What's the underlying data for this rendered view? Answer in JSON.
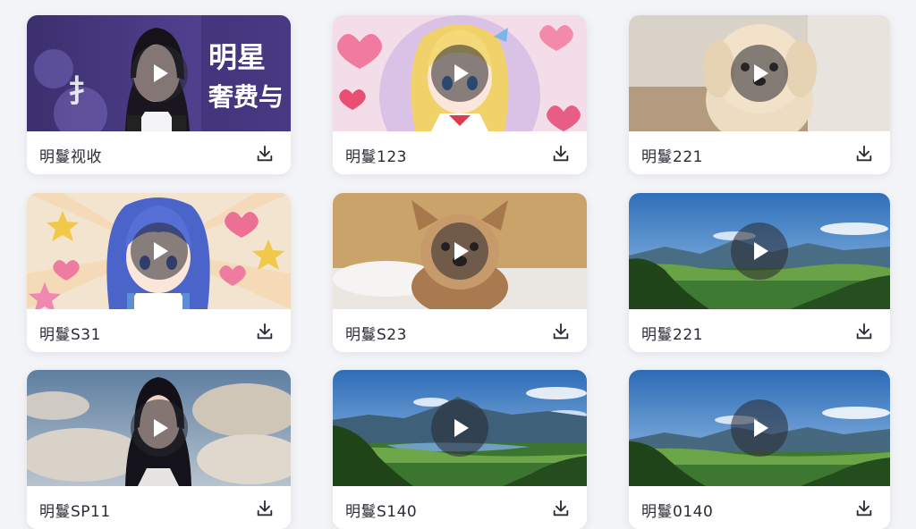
{
  "gallery": {
    "cards": [
      {
        "title": "明鬘视收",
        "thumbnail": "presenter-woman-purple",
        "thumb_text": [
          "明星",
          "奢费与"
        ],
        "thumb_logo": "扌"
      },
      {
        "title": "明鬘123",
        "thumbnail": "anime-blonde-girl-hearts"
      },
      {
        "title": "明鬘221",
        "thumbnail": "fluffy-dog-indoor"
      },
      {
        "title": "明鬘S31",
        "thumbnail": "anime-blue-hair-girl-stars"
      },
      {
        "title": "明鬘S23",
        "thumbnail": "yorkie-dog-on-bed"
      },
      {
        "title": "明鬘221",
        "thumbnail": "mountain-valley-landscape"
      },
      {
        "title": "明鬘SP11",
        "thumbnail": "woman-clouds-sky"
      },
      {
        "title": "明鬘S140",
        "thumbnail": "mountain-lake-landscape"
      },
      {
        "title": "明鬘0140",
        "thumbnail": "mountain-valley-landscape"
      }
    ],
    "play_icon": "play-icon",
    "download_icon": "download-icon"
  },
  "colors": {
    "background": "#f3f4f7",
    "card": "#ffffff",
    "play_overlay": "#28283099",
    "text": "#2a2c33"
  }
}
